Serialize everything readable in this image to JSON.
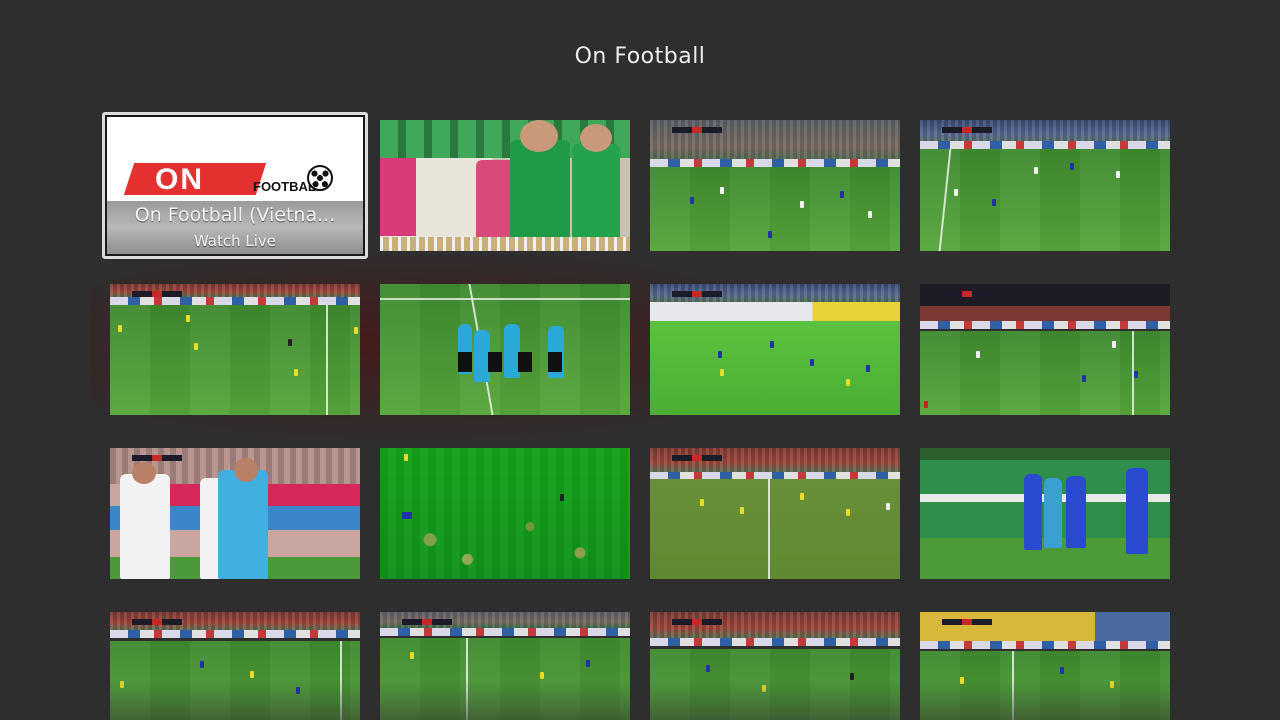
{
  "screen": {
    "title": "On Football"
  },
  "selected_tile": {
    "logo_text": "ON",
    "logo_sub": "FOOTBALL",
    "title": "On Football (Vietna...",
    "action": "Watch Live"
  },
  "colors": {
    "background": "#2e2e2e",
    "logo_red": "#e53030",
    "focus_border": "#dcdcdc"
  },
  "tiles": [
    {
      "name": "video-thumbnail-1",
      "kind": "logo"
    },
    {
      "name": "video-thumbnail-2",
      "kind": "closeup-players"
    },
    {
      "name": "video-thumbnail-3",
      "kind": "wide-pitch"
    },
    {
      "name": "video-thumbnail-4",
      "kind": "wide-pitch"
    },
    {
      "name": "video-thumbnail-5",
      "kind": "wide-pitch"
    },
    {
      "name": "video-thumbnail-6",
      "kind": "referees"
    },
    {
      "name": "video-thumbnail-7",
      "kind": "wide-pitch"
    },
    {
      "name": "video-thumbnail-8",
      "kind": "wide-pitch"
    },
    {
      "name": "video-thumbnail-9",
      "kind": "closeup-players"
    },
    {
      "name": "video-thumbnail-10",
      "kind": "green-pitch"
    },
    {
      "name": "video-thumbnail-11",
      "kind": "wide-pitch"
    },
    {
      "name": "video-thumbnail-12",
      "kind": "closeup-players"
    },
    {
      "name": "video-thumbnail-13",
      "kind": "wide-pitch"
    },
    {
      "name": "video-thumbnail-14",
      "kind": "wide-pitch"
    },
    {
      "name": "video-thumbnail-15",
      "kind": "wide-pitch"
    },
    {
      "name": "video-thumbnail-16",
      "kind": "wide-pitch"
    }
  ]
}
